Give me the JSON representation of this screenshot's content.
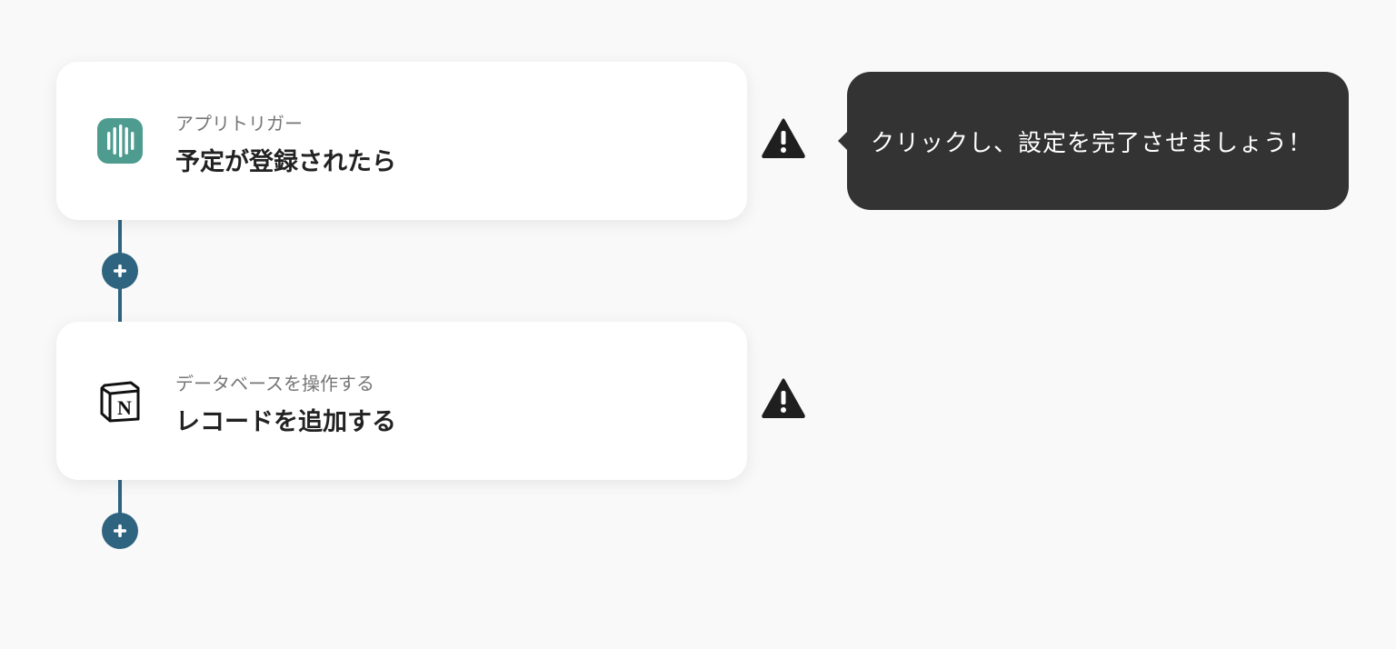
{
  "flow": {
    "steps": [
      {
        "subtitle": "アプリトリガー",
        "title": "予定が登録されたら",
        "icon": "timerex-waveform-icon",
        "icon_color": "#4e9b8f",
        "status": "warning"
      },
      {
        "subtitle": "データベースを操作する",
        "title": "レコードを追加する",
        "icon": "notion-icon",
        "icon_color": "#111111",
        "status": "warning"
      }
    ],
    "add_step_icon": "plus-icon",
    "connector_color": "#2e6480"
  },
  "tooltip": {
    "text": "クリックし、設定を完了させましょう！"
  }
}
